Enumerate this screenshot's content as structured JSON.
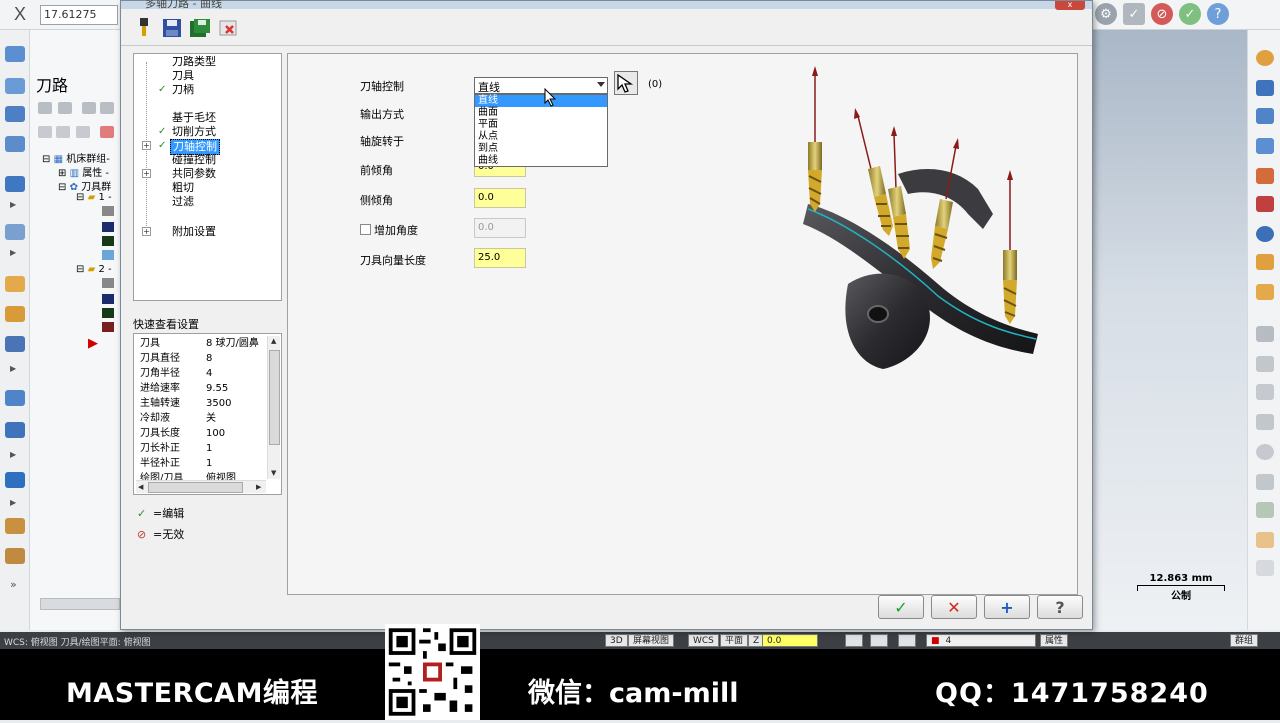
{
  "background": {
    "x_label": "X",
    "x_value": "17.61275",
    "panel_title": "刀路",
    "tree_items": [
      "机床群组-",
      "属性 -",
      "刀具群",
      "1 -",
      "2 -"
    ],
    "scale_value": "12.863 mm",
    "scale_unit": "公制",
    "status_left": "WCS: 俯视图  刀具/绘图平面: 俯视图",
    "status_items": [
      "3D",
      "屏幕视图",
      "WCS",
      "平面",
      "Z",
      "0.0",
      "4",
      "属性",
      "群组"
    ]
  },
  "dialog": {
    "title": "多轴刀路 - 曲线",
    "close_label": "x",
    "toolbar": [
      "pen-icon",
      "save-icon",
      "save-all-icon",
      "delete-icon"
    ],
    "tree": [
      {
        "label": "刀路类型",
        "check": "",
        "expand": ""
      },
      {
        "label": "刀具",
        "check": "",
        "expand": ""
      },
      {
        "label": "刀柄",
        "check": "✓",
        "expand": ""
      },
      {
        "label": "",
        "check": "",
        "expand": ""
      },
      {
        "label": "基于毛坯",
        "check": "",
        "expand": ""
      },
      {
        "label": "切削方式",
        "check": "✓",
        "expand": ""
      },
      {
        "label": "刀轴控制",
        "check": "✓",
        "expand": "+"
      },
      {
        "label": "碰撞控制",
        "check": "",
        "expand": ""
      },
      {
        "label": "共同参数",
        "check": "",
        "expand": "+"
      },
      {
        "label": "粗切",
        "check": "",
        "expand": ""
      },
      {
        "label": "过滤",
        "check": "",
        "expand": ""
      },
      {
        "label": "",
        "check": "",
        "expand": ""
      },
      {
        "label": "附加设置",
        "check": "",
        "expand": "+"
      }
    ],
    "quick_view_title": "快速查看设置",
    "quick_view": [
      {
        "key": "刀具",
        "value": "8 球刀/圆鼻"
      },
      {
        "key": "刀具直径",
        "value": "8"
      },
      {
        "key": "刀角半径",
        "value": "4"
      },
      {
        "key": "进给速率",
        "value": "9.55"
      },
      {
        "key": "主轴转速",
        "value": "3500"
      },
      {
        "key": "冷却液",
        "value": "关"
      },
      {
        "key": "刀具长度",
        "value": "100"
      },
      {
        "key": "刀长补正",
        "value": "1"
      },
      {
        "key": "半径补正",
        "value": "1"
      },
      {
        "key": "绘图/刀具",
        "value": "俯视图"
      }
    ],
    "legend": [
      {
        "symbol": "✓",
        "text": "=编辑",
        "color": "#2e8b2e"
      },
      {
        "symbol": "⊘",
        "text": "=无效",
        "color": "#c0392b"
      }
    ],
    "form": {
      "axis_control_label": "刀轴控制",
      "axis_control_value": "直线",
      "dropdown_options": [
        "直线",
        "曲面",
        "平面",
        "从点",
        "到点",
        "曲线"
      ],
      "pick_count": "(0)",
      "output_label": "输出方式",
      "axis_rotate_label": "轴旋转于",
      "lead_angle_label": "前倾角",
      "lead_angle_value": "0.0",
      "side_angle_label": "侧倾角",
      "side_angle_value": "0.0",
      "add_angle_label": "增加角度",
      "add_angle_value": "0.0",
      "tool_vector_label": "刀具向量长度",
      "tool_vector_value": "25.0"
    },
    "buttons": [
      "✓",
      "✕",
      "+",
      "?"
    ]
  },
  "banner": {
    "left": "MASTERCAM编程",
    "mid": "微信：cam-mill",
    "right": "QQ：1471758240"
  }
}
